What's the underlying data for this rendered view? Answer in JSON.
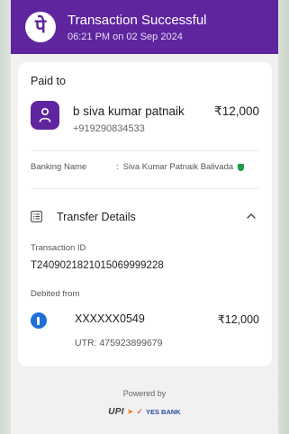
{
  "header": {
    "logo_glyph": "पे",
    "title": "Transaction Successful",
    "subtitle": "06:21 PM on 02 Sep 2024",
    "brand_color": "#5f259f"
  },
  "paid_to": {
    "section_label": "Paid to",
    "payee_name": "b siva kumar patnaik",
    "payee_phone": "+919290834533",
    "amount": "₹12,000",
    "avatar_icon": "person-icon"
  },
  "banking": {
    "label": "Banking Name",
    "separator": ":",
    "value": "Siva Kumar Patnaik Balivada",
    "verified_icon": "verified-shield-icon"
  },
  "transfer_details": {
    "title": "Transfer Details",
    "expanded": true,
    "transaction_id_label": "Transaction ID",
    "transaction_id": "T2409021821015069999228",
    "debited_from_label": "Debited from",
    "account_masked": "XXXXXX0549",
    "amount": "₹12,000",
    "utr": "UTR: 475923899679"
  },
  "footer": {
    "powered_by": "Powered by",
    "upi_text": "UPI",
    "bank_name": "YES BANK"
  }
}
